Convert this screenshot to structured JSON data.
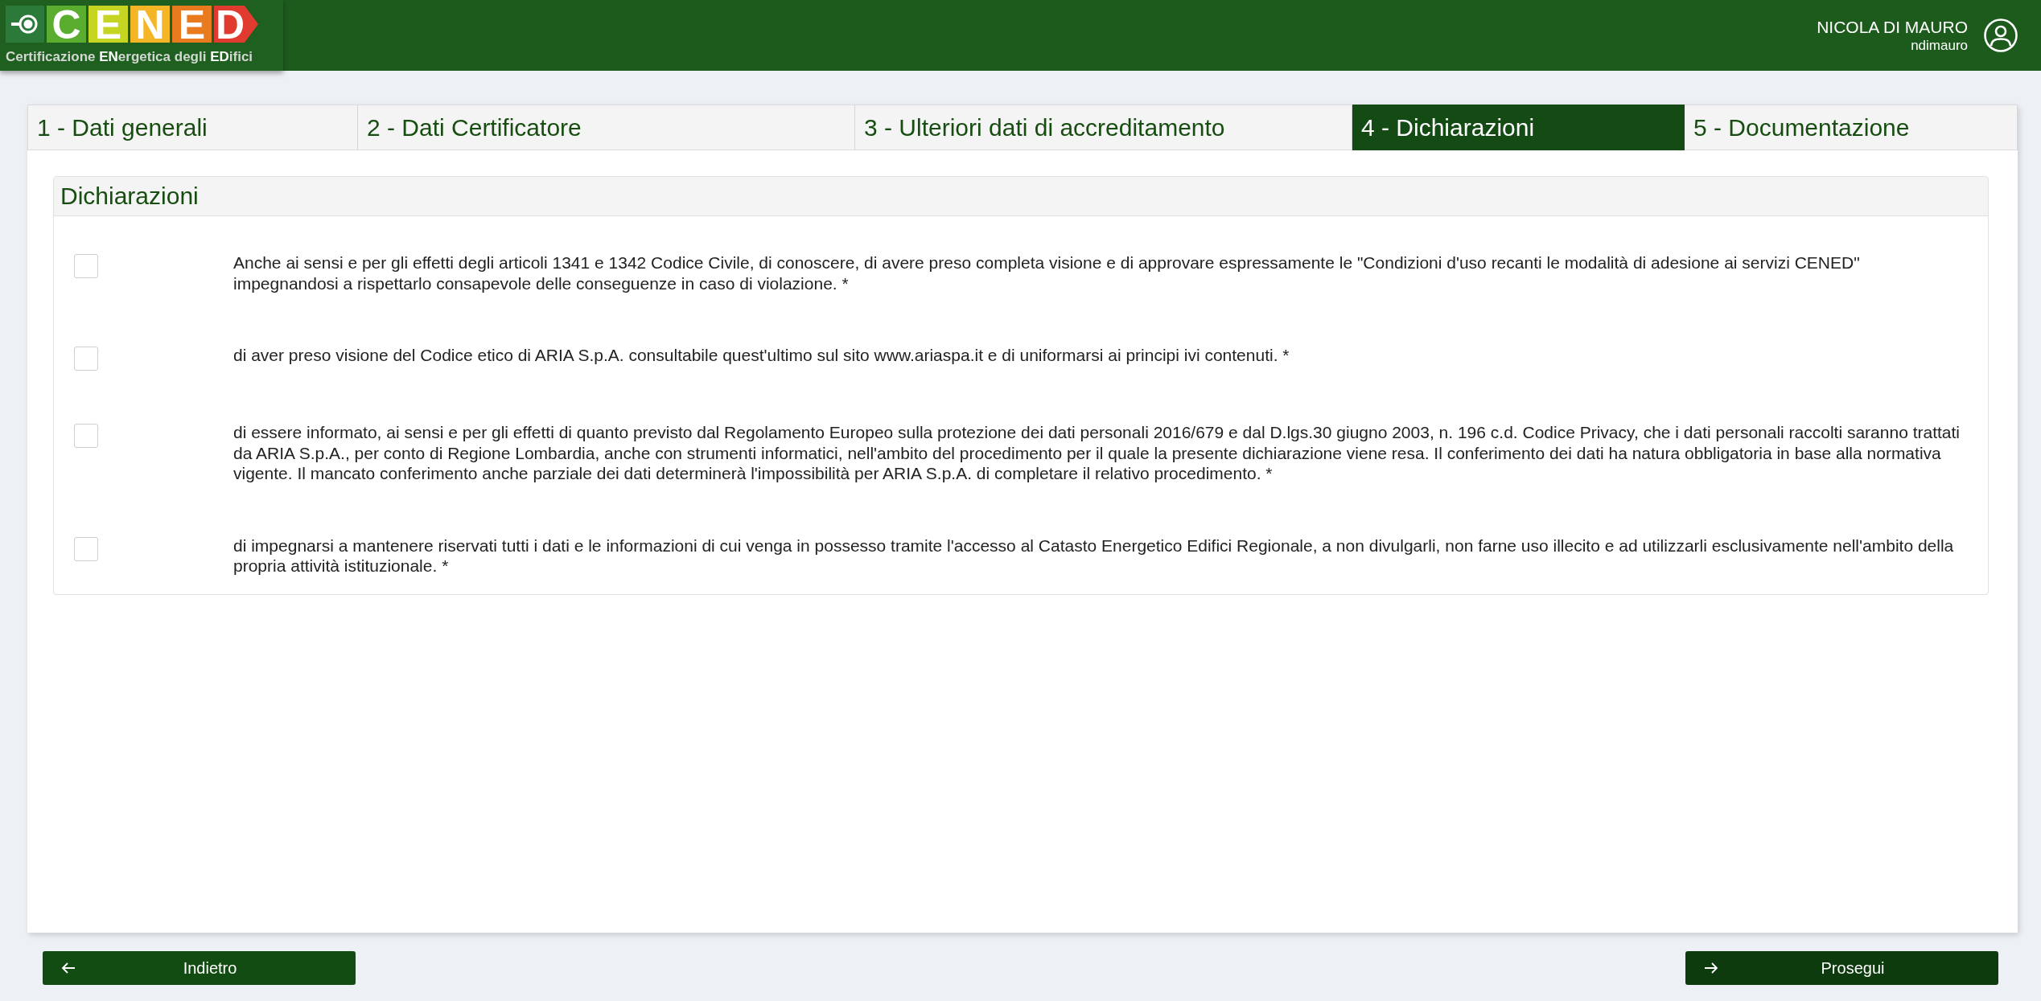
{
  "header": {
    "logo": {
      "letters": [
        {
          "letter": "C",
          "color": "#5aad2f"
        },
        {
          "letter": "E",
          "color": "#c6d422"
        },
        {
          "letter": "N",
          "color": "#f4b526"
        },
        {
          "letter": "E",
          "color": "#ea7a1e"
        },
        {
          "letter": "D",
          "color": "#e03b2e"
        }
      ],
      "subtitle": "Certificazione **EN**ergetica degli **ED**ifici"
    },
    "user": {
      "name": "NICOLA DI MAURO",
      "username": "ndimauro"
    }
  },
  "tabs": [
    {
      "label": "1 - Dati generali",
      "selected": false
    },
    {
      "label": "2 - Dati Certificatore",
      "selected": false
    },
    {
      "label": "3 - Ulteriori dati di accreditamento",
      "selected": false
    },
    {
      "label": "4 - Dichiarazioni",
      "selected": true
    },
    {
      "label": "5 - Documentazione",
      "selected": false
    }
  ],
  "panel": {
    "title": "Dichiarazioni",
    "declarations": [
      {
        "text": "Anche ai sensi e per gli effetti degli articoli 1341 e 1342 Codice Civile, di conoscere, di avere preso completa visione e di approvare espressamente le \"Condizioni d'uso recanti le modalità di adesione ai servizi CENED\" impegnandosi a rispettarlo consapevole delle conseguenze in caso di violazione. *",
        "checked": false
      },
      {
        "text": "di aver preso visione del Codice etico di ARIA S.p.A. consultabile quest'ultimo sul sito www.ariaspa.it e di uniformarsi ai principi ivi contenuti. *",
        "checked": false
      },
      {
        "text": "di essere informato, ai sensi e per gli effetti di quanto previsto dal Regolamento Europeo sulla protezione dei dati personali 2016/679 e dal D.lgs.30 giugno 2003, n. 196 c.d. Codice Privacy, che i dati personali raccolti saranno trattati da ARIA S.p.A., per conto di Regione Lombardia, anche con strumenti informatici, nell'ambito del procedimento per il quale la presente dichiarazione viene resa. Il conferimento dei dati ha natura obbligatoria in base alla normativa vigente. Il mancato conferimento anche parziale dei dati determinerà l'impossibilità per ARIA S.p.A. di completare il relativo procedimento. *",
        "checked": false
      },
      {
        "text": "di impegnarsi a mantenere riservati tutti i dati e le informazioni di cui venga in possesso tramite l'accesso al Catasto Energetico Edifici Regionale, a non divulgarli, non farne uso illecito e ad utilizzarli esclusivamente nell'ambito della propria attività istituzionale. *",
        "checked": false
      }
    ]
  },
  "buttons": [
    {
      "label": "Indietro",
      "kind": "back"
    },
    {
      "label": "Prosegui",
      "kind": "next"
    }
  ]
}
